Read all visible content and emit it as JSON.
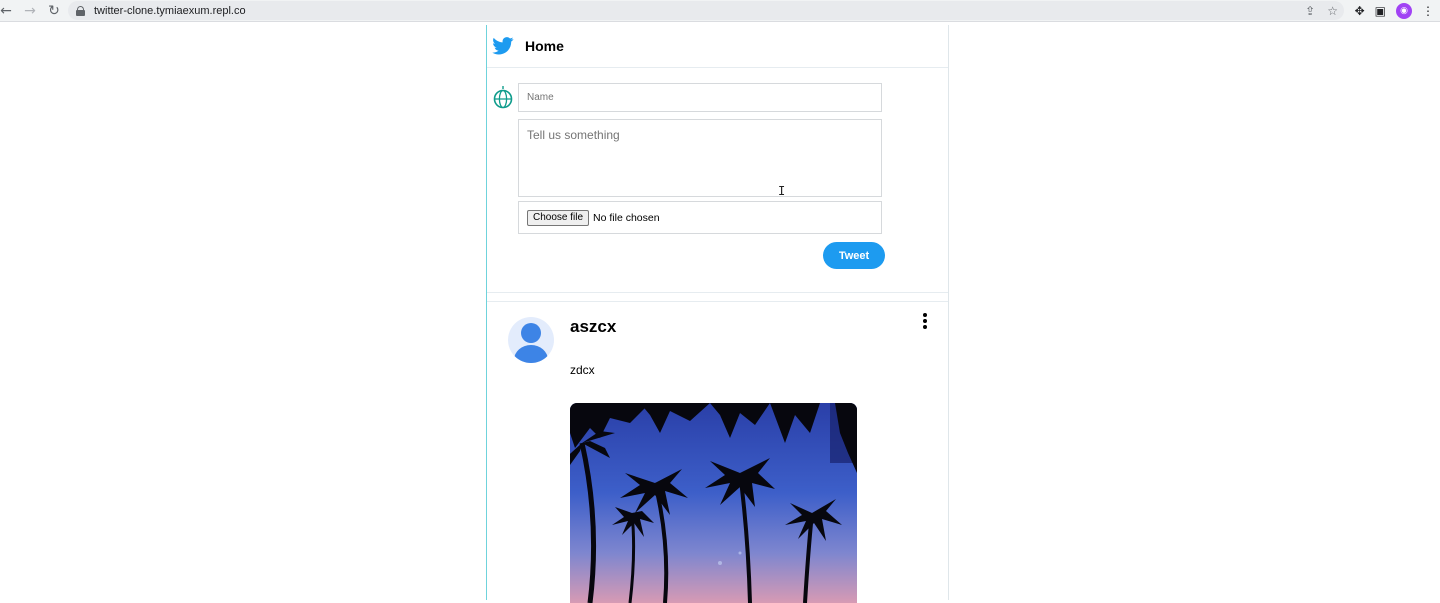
{
  "browser": {
    "url": "twitter-clone.tymiaexum.repl.co",
    "back_icon": "arrow-left-icon",
    "forward_icon": "arrow-right-icon",
    "reload_icon": "reload-icon",
    "lock_icon": "lock-icon",
    "profile_initial": "🔒"
  },
  "header": {
    "title": "Home",
    "logo_color": "#1d9bf0"
  },
  "composer": {
    "name_placeholder": "Name",
    "message_placeholder": "Tell us something",
    "choose_file_label": "Choose file",
    "file_status": "No file chosen",
    "tweet_label": "Tweet",
    "accent_color": "#1d9bf0"
  },
  "post": {
    "name": "aszcx",
    "text": "zdcx"
  }
}
